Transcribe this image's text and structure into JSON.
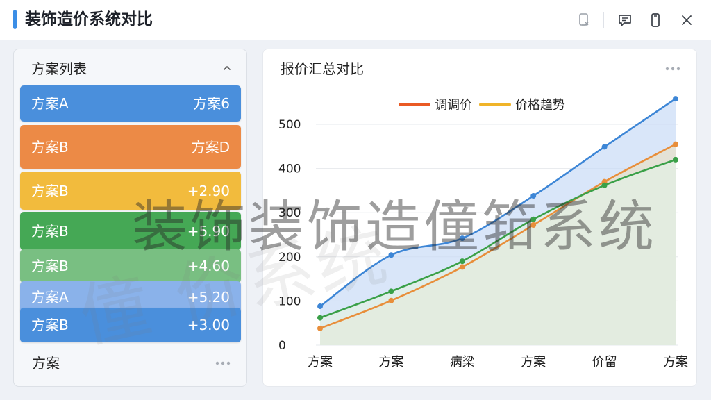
{
  "app": {
    "title": "装饰造价系统对比",
    "accent_color": "#3b8ee6"
  },
  "header_icons": [
    {
      "name": "device-sync-icon"
    },
    {
      "name": "comment-icon"
    },
    {
      "name": "mobile-icon"
    },
    {
      "name": "close-icon"
    }
  ],
  "left_panel": {
    "title": "方案列表",
    "collapse_icon": "chevron-up-icon",
    "items": [
      {
        "label": "方案A",
        "value": "方案6",
        "color": "#4a8fdc"
      },
      {
        "label": "方案B",
        "value": "方案D",
        "color": "#ec8a46"
      },
      {
        "label": "方案B",
        "value": "+2.90",
        "color": "#f2bb3d"
      },
      {
        "label": "方案B",
        "value": "+5.90",
        "color": "#45a855"
      },
      {
        "label": "方案B",
        "value": "+4.60",
        "color": "#79bf82"
      },
      {
        "label": "方案A",
        "value": "+5.20",
        "color": "#8ab2ea"
      },
      {
        "label": "方案B",
        "value": "+3.00",
        "color": "#4a8fdc"
      }
    ],
    "footer_label": "方案",
    "footer_more_icon": "more-horizontal-icon"
  },
  "chart_panel": {
    "title": "报价汇总对比",
    "more_icon": "more-horizontal-icon"
  },
  "chart_data": {
    "type": "line",
    "title": "",
    "legend": [
      {
        "name": "调调价",
        "color": "#ea5a24"
      },
      {
        "name": "价格趋势",
        "color": "#f0b429"
      }
    ],
    "legend_position": "top",
    "categories": [
      "方案",
      "方案",
      "病梁",
      "方案",
      "价留",
      "方案"
    ],
    "yticks": [
      "0",
      "100",
      "200",
      "300",
      "400",
      "500"
    ],
    "ylim": [
      0,
      500
    ],
    "grid": true,
    "series": [
      {
        "color": "#3d86d6",
        "fill": "#c9dcf6",
        "values": [
          88,
          204,
          242,
          338,
          449,
          558
        ]
      },
      {
        "color": "#e88e3a",
        "fill": "#e8e0c8",
        "values": [
          38,
          101,
          177,
          272,
          370,
          455
        ]
      },
      {
        "color": "#3aa048",
        "fill": "#e2f1e4",
        "values": [
          62,
          122,
          190,
          285,
          362,
          420
        ]
      }
    ]
  },
  "watermark": {
    "text": "装饰装饰造僮筘系统",
    "faint_text": "僮 价系统"
  }
}
